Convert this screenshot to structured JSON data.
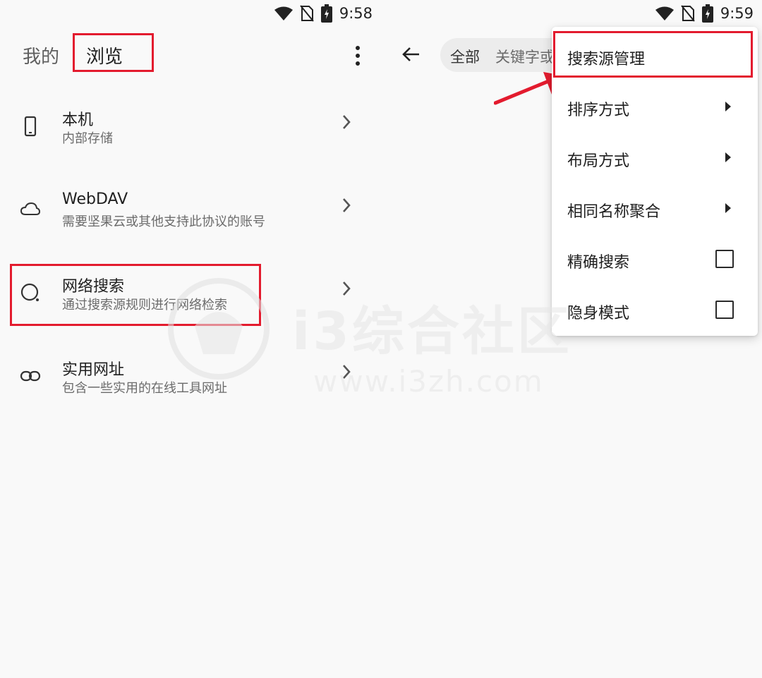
{
  "left": {
    "status": {
      "time": "9:58"
    },
    "header": {
      "tab_mine": "我的",
      "tab_browse": "浏览"
    },
    "items": [
      {
        "title": "本机",
        "subtitle": "内部存储",
        "icon": "phone-icon"
      },
      {
        "title": "WebDAV",
        "subtitle": "需要坚果云或其他支持此协议的账号",
        "icon": "cloud-icon"
      },
      {
        "title": "网络搜索",
        "subtitle": "通过搜索源规则进行网络检索",
        "icon": "search-circle-icon"
      },
      {
        "title": "实用网址",
        "subtitle": "包含一些实用的在线工具网址",
        "icon": "link-icon"
      }
    ]
  },
  "right": {
    "status": {
      "time": "9:59"
    },
    "search": {
      "scope": "全部",
      "placeholder": "关键字或"
    },
    "menu": {
      "items": [
        {
          "label": "搜索源管理",
          "kind": "action"
        },
        {
          "label": "排序方式",
          "kind": "submenu"
        },
        {
          "label": "布局方式",
          "kind": "submenu"
        },
        {
          "label": "相同名称聚合",
          "kind": "submenu"
        },
        {
          "label": "精确搜索",
          "kind": "checkbox",
          "checked": false
        },
        {
          "label": "隐身模式",
          "kind": "checkbox",
          "checked": false
        }
      ]
    }
  },
  "watermark": {
    "text": "i3综合社区",
    "url": "www.i3zh.com"
  },
  "colors": {
    "highlight": "#e31b2e",
    "background": "#f9f9f9",
    "menu_bg": "#ffffff"
  }
}
